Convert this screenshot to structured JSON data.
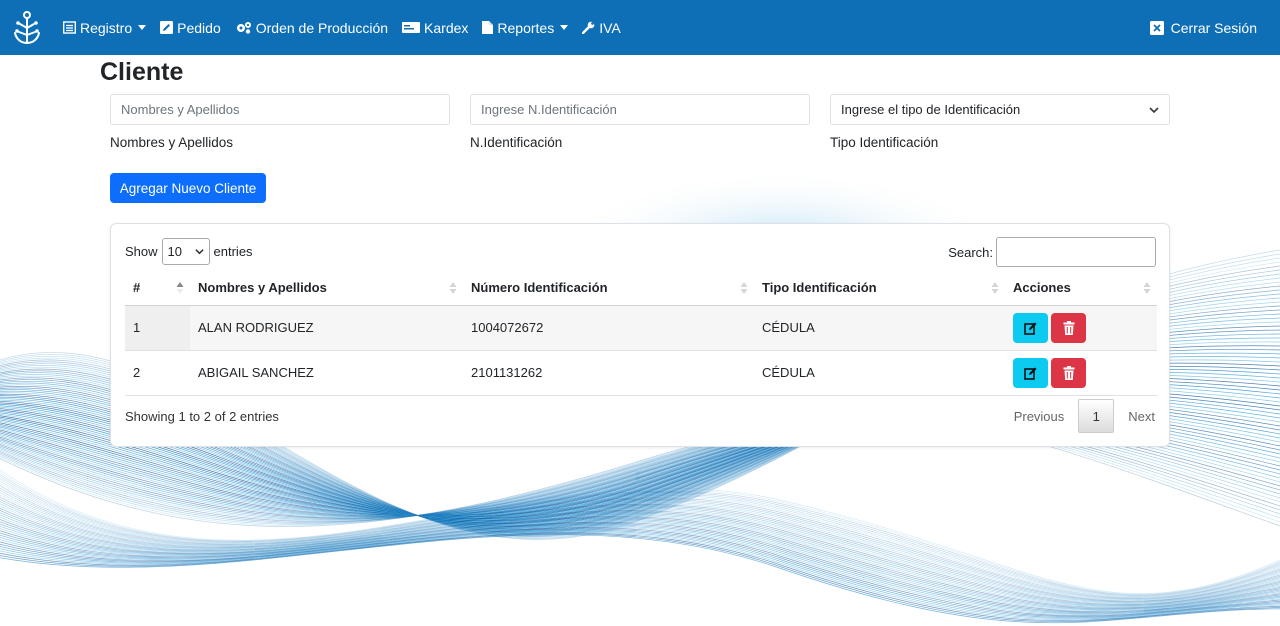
{
  "navbar": {
    "menu": [
      {
        "label": "Registro",
        "icon": "list-alt-icon",
        "dropdown": true
      },
      {
        "label": "Pedido",
        "icon": "edit-square-icon",
        "dropdown": false
      },
      {
        "label": "Orden de Producción",
        "icon": "cogs-icon",
        "dropdown": false
      },
      {
        "label": "Kardex",
        "icon": "id-card-icon",
        "dropdown": false
      },
      {
        "label": "Reportes",
        "icon": "file-icon",
        "dropdown": true
      },
      {
        "label": "IVA",
        "icon": "wrench-icon",
        "dropdown": false
      }
    ],
    "logout_label": "Cerrar Sesión"
  },
  "page": {
    "title": "Cliente"
  },
  "form": {
    "name_placeholder": "Nombres y Apellidos",
    "name_label": "Nombres y Apellidos",
    "id_placeholder": "Ingrese N.Identificación",
    "id_label": "N.Identificación",
    "type_selected": "Ingrese el tipo de Identificación",
    "type_label": "Tipo Identificación",
    "add_button": "Agregar Nuevo Cliente"
  },
  "table": {
    "show_label": "Show",
    "entries_value": "10",
    "entries_label": "entries",
    "search_label": "Search:",
    "columns": [
      "#",
      "Nombres y Apellidos",
      "Número Identificación",
      "Tipo Identificación",
      "Acciones"
    ],
    "rows": [
      {
        "num": "1",
        "name": "ALAN RODRIGUEZ",
        "id": "1004072672",
        "type": "CÉDULA"
      },
      {
        "num": "2",
        "name": "ABIGAIL SANCHEZ",
        "id": "2101131262",
        "type": "CÉDULA"
      }
    ],
    "info": "Showing 1 to 2 of 2 entries",
    "pagination": {
      "previous": "Previous",
      "current": "1",
      "next": "Next"
    }
  },
  "colors": {
    "navbar": "#0e6fb7",
    "primary": "#0d6efd",
    "edit": "#0dcaf0",
    "delete": "#dc3545"
  }
}
